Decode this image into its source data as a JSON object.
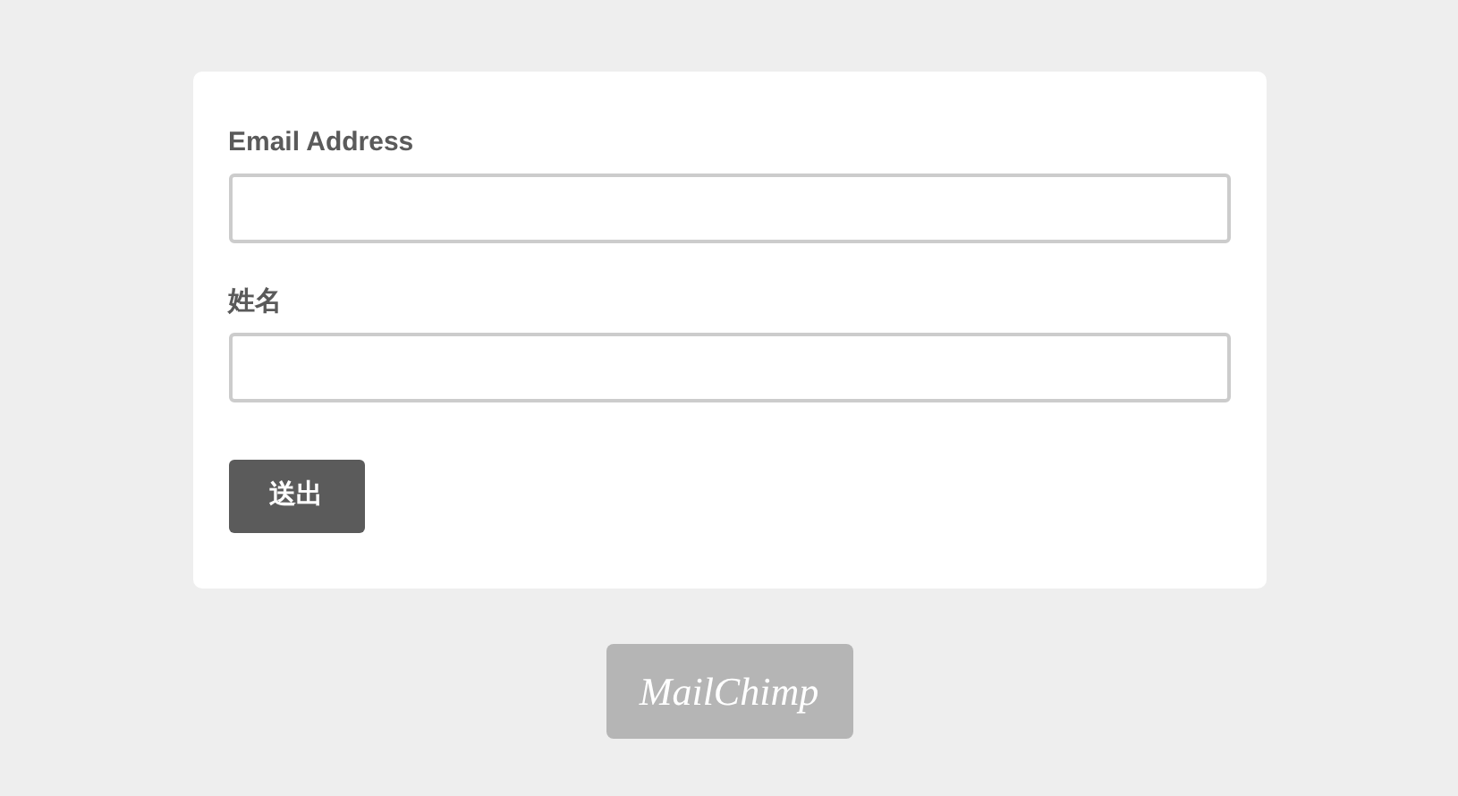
{
  "form": {
    "fields": [
      {
        "label": "Email Address"
      },
      {
        "label": "姓名"
      }
    ],
    "submit": "送出"
  },
  "badge": {
    "text": "MailChimp"
  }
}
